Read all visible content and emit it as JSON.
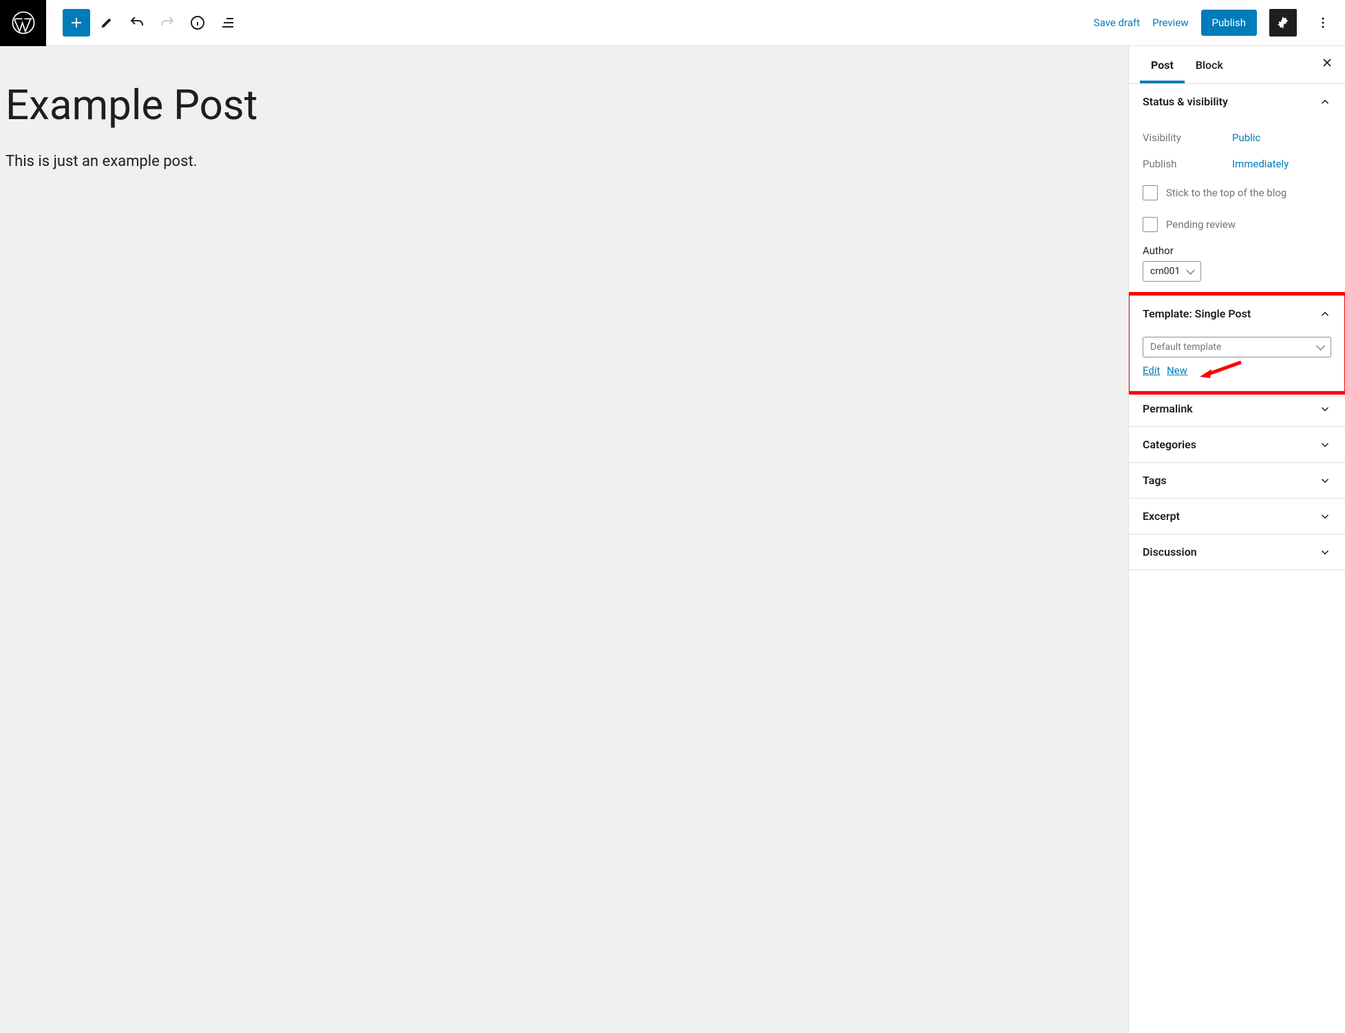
{
  "toolbar": {
    "save_draft": "Save draft",
    "preview": "Preview",
    "publish": "Publish"
  },
  "editor": {
    "title": "Example Post",
    "body": "This is just an example post."
  },
  "sidebar": {
    "tabs": {
      "post": "Post",
      "block": "Block"
    },
    "panels": {
      "status": {
        "title": "Status & visibility",
        "visibility_label": "Visibility",
        "visibility_value": "Public",
        "publish_label": "Publish",
        "publish_value": "Immediately",
        "sticky_label": "Stick to the top of the blog",
        "pending_label": "Pending review",
        "author_label": "Author",
        "author_value": "crn001"
      },
      "template": {
        "title": "Template: Single Post",
        "select_value": "Default template",
        "edit": "Edit",
        "new": "New"
      },
      "permalink": "Permalink",
      "categories": "Categories",
      "tags": "Tags",
      "excerpt": "Excerpt",
      "discussion": "Discussion"
    }
  }
}
